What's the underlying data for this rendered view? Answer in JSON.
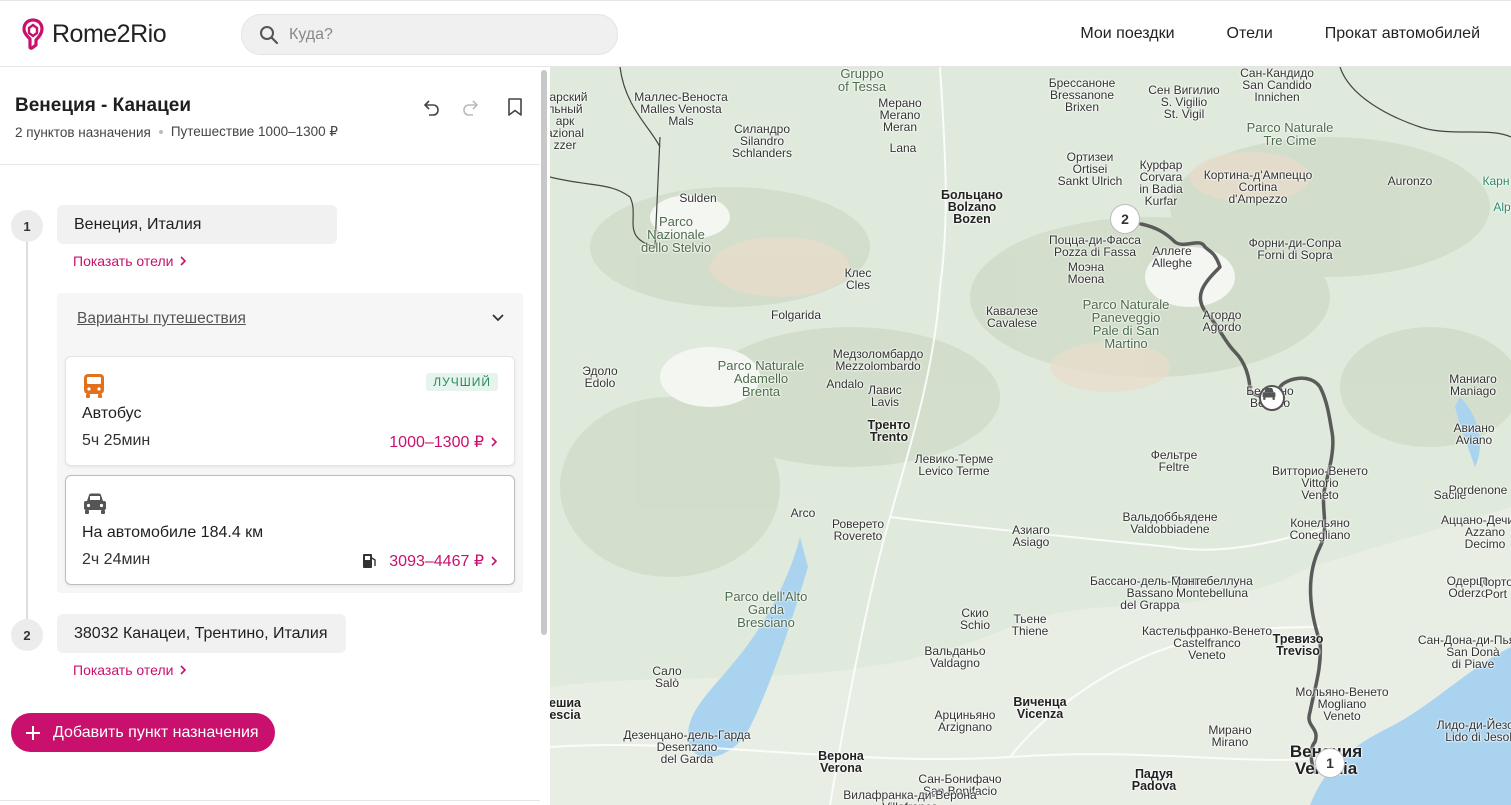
{
  "header": {
    "logo_text": "Rome2Rio",
    "search_placeholder": "Куда?",
    "nav": [
      "Мои поездки",
      "Отели",
      "Прокат автомобилей"
    ]
  },
  "trip": {
    "title": "Венеция - Канацеи",
    "destinations_count": "2 пунктов назначения",
    "trip_price": "Путешествие 1000–1300 ₽",
    "stops": [
      {
        "number": "1",
        "name": "Венеция, Италия",
        "hotels_link": "Показать отели"
      },
      {
        "number": "2",
        "name": "38032 Канацеи, Трентино, Италия",
        "hotels_link": "Показать отели"
      }
    ],
    "options_title": "Варианты путешествия",
    "options": [
      {
        "icon": "bus-icon",
        "mode": "Автобус",
        "badge": "ЛУЧШИЙ",
        "duration": "5ч 25мин",
        "price": "1000–1300 ₽"
      },
      {
        "icon": "car-icon",
        "mode": "На автомобиле 184.4 км",
        "duration": "2ч 24мин",
        "price": "3093–4467 ₽",
        "extra_icon": "fuel-icon"
      }
    ],
    "add_button": "Добавить пункт назначения"
  },
  "colors": {
    "accent": "#c8106c",
    "bus": "#e2711d",
    "route": "#5a5a5a",
    "water": "#a9d3ef",
    "land": "#dfeadc"
  },
  "map": {
    "markers": {
      "start": "1",
      "end": "2"
    },
    "labels": [
      {
        "t": "Gruppo\nof Tessa",
        "c": "park"
      },
      {
        "t": "Маллес-Веноста\nMalles Venosta\nMals",
        "c": ""
      },
      {
        "t": "Мерано\nMerano\nMeran",
        "c": ""
      },
      {
        "t": "Брессаноне\nBressanone\nBrixen",
        "c": ""
      },
      {
        "t": "Сан-Кандидо\nSan Candido\nInnichen",
        "c": ""
      },
      {
        "t": "Сен Вигилио\nS. Vigilio\nSt. Vigil",
        "c": ""
      },
      {
        "t": "Parco Naturale\nTre Cime",
        "c": "park"
      },
      {
        "t": "Силандро\nSilandro\nSchlanders",
        "c": ""
      },
      {
        "t": "Lana",
        "c": ""
      },
      {
        "t": "Ортизеи\nOrtisei\nSankt Ulrich",
        "c": ""
      },
      {
        "t": "Курфар\nCorvara\nin Badia\nKurfar",
        "c": ""
      },
      {
        "t": "Кортина-д'Ампеццо\nCortina\nd'Ampezzo",
        "c": ""
      },
      {
        "t": "Auronzo",
        "c": ""
      },
      {
        "t": "Sulden",
        "c": ""
      },
      {
        "t": "Больцано\nBolzano\nBozen",
        "c": "city"
      },
      {
        "t": "Parco\nNazionale\ndello Stelvio",
        "c": "park"
      },
      {
        "t": "Поцца-ди-Фасса\nPozza di Fassa",
        "c": ""
      },
      {
        "t": "Аллеге\nAlleghe",
        "c": ""
      },
      {
        "t": "Форни-ди-Сопра\nForni di Sopra",
        "c": ""
      },
      {
        "t": "Клес\nCles",
        "c": ""
      },
      {
        "t": "Моэна\nMoena",
        "c": ""
      },
      {
        "t": "Folgarida",
        "c": ""
      },
      {
        "t": "Кавалезе\nCavalese",
        "c": ""
      },
      {
        "t": "Parco Naturale\nPaneveggio\nPale di San\nMartino",
        "c": "park"
      },
      {
        "t": "Агордо\nAgordo",
        "c": ""
      },
      {
        "t": "Эдоло\nEdolo",
        "c": ""
      },
      {
        "t": "Parco Naturale\nAdamello\nBrenta",
        "c": "park"
      },
      {
        "t": "Медзоломбардо\nMezzolombardo",
        "c": ""
      },
      {
        "t": "Andalo",
        "c": ""
      },
      {
        "t": "Беллуно\nBelluno",
        "c": ""
      },
      {
        "t": "Маниаго\nManiago",
        "c": ""
      },
      {
        "t": "Лавис\nLavis",
        "c": ""
      },
      {
        "t": "Тренто\nTrento",
        "c": "city"
      },
      {
        "t": "Левико-Терме\nLevico Terme",
        "c": ""
      },
      {
        "t": "Фельтре\nFeltre",
        "c": ""
      },
      {
        "t": "Авиано\nAviano",
        "c": ""
      },
      {
        "t": "Витторио-Венето\nVittorio\nVeneto",
        "c": ""
      },
      {
        "t": "Sacile",
        "c": ""
      },
      {
        "t": "Pordenone",
        "c": ""
      },
      {
        "t": "Arco",
        "c": ""
      },
      {
        "t": "Роверето\nRovereto",
        "c": ""
      },
      {
        "t": "Азиаго\nAsiago",
        "c": ""
      },
      {
        "t": "Вальдоббьядене\nValdobbiadene",
        "c": ""
      },
      {
        "t": "Конельяно\nConegliano",
        "c": ""
      },
      {
        "t": "Аццано-Дечимо\nAzzano\nDecimo",
        "c": ""
      },
      {
        "t": "Бассано-дель-Граппа\nBassano\ndel Grappa",
        "c": ""
      },
      {
        "t": "Монтебеллуна\nMontebelluna",
        "c": ""
      },
      {
        "t": "Одерцо\nOderzo",
        "c": ""
      },
      {
        "t": "Parco dell'Alto\nGarda\nBresciano",
        "c": "park"
      },
      {
        "t": "Скио\nSchio",
        "c": ""
      },
      {
        "t": "Тьене\nThiene",
        "c": ""
      },
      {
        "t": "Кастельфранко-Венето\nCastelfranco\nVeneto",
        "c": ""
      },
      {
        "t": "Тревизо\nTreviso",
        "c": "city"
      },
      {
        "t": "Сан-Дона-ди-Пьяве\nSan Donà\ndi Piave",
        "c": ""
      },
      {
        "t": "Вальданьо\nValdagno",
        "c": ""
      },
      {
        "t": "Сало\nSalò",
        "c": ""
      },
      {
        "t": "Мольяно-Венето\nMogliano\nVeneto",
        "c": ""
      },
      {
        "t": "Виченца\nVicenza",
        "c": "city"
      },
      {
        "t": "Арциньяно\nArzignano",
        "c": ""
      },
      {
        "t": "Мирано\nMirano",
        "c": ""
      },
      {
        "t": "Лидо-ди-Йезоло\nLido di Jesolo",
        "c": ""
      },
      {
        "t": "Дезенцано-дель-Гарда\nDesenzano\ndel Garda",
        "c": ""
      },
      {
        "t": "Верона\nVerona",
        "c": "city"
      },
      {
        "t": "Сан-Бонифачо\nSan Bonifacio",
        "c": ""
      },
      {
        "t": "Падуя\nPadova",
        "c": "city"
      },
      {
        "t": "Венеция\nVenezia",
        "c": "big"
      },
      {
        "t": "Вилафранка-ди-Верона\nVillafranca",
        "c": ""
      },
      {
        "t": "ешиа\nescia",
        "c": "city"
      },
      {
        "t": "Карн",
        "c": "green"
      },
      {
        "t": "Alp",
        "c": "green"
      },
      {
        "t": "Порто\nPort",
        "c": ""
      },
      {
        "t": "дарский\nльный\nарк\nazional\nzzer",
        "c": ""
      }
    ]
  }
}
